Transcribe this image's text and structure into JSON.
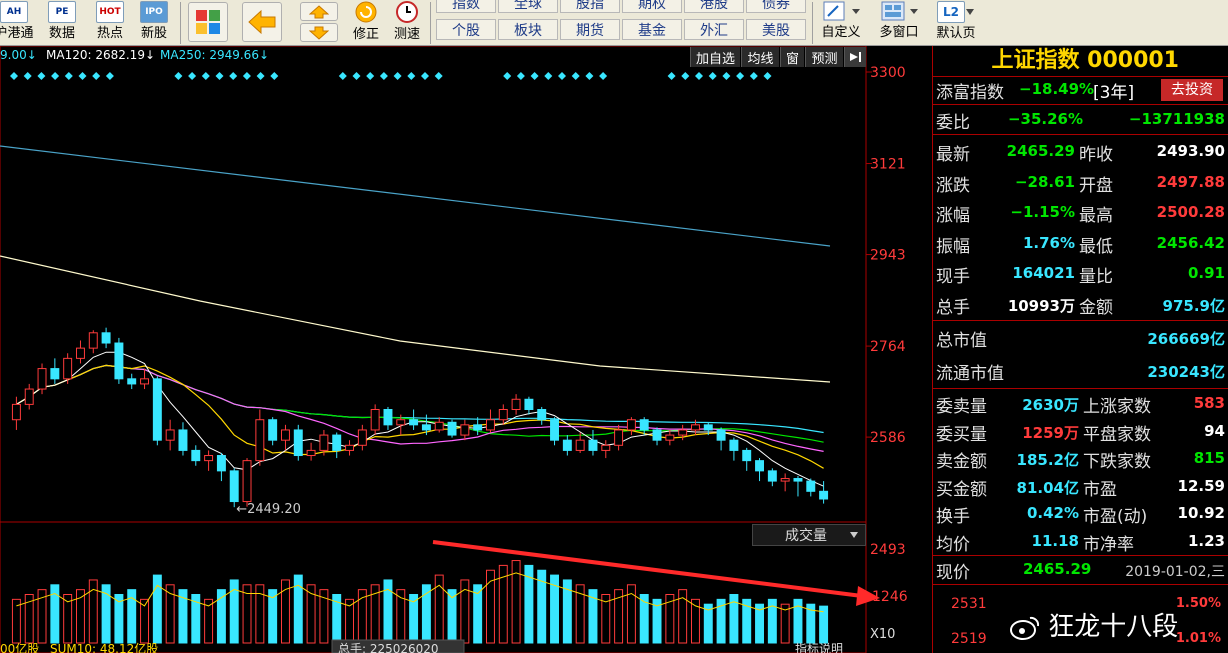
{
  "toolbar": {
    "buttons": [
      {
        "label": "沪港通",
        "icon": "AH"
      },
      {
        "label": "数据",
        "icon": "PE"
      },
      {
        "label": "热点",
        "icon": "HOT"
      },
      {
        "label": "新股",
        "icon": "IPO"
      }
    ],
    "adjust_label": "修正",
    "test_label": "测速",
    "market_grid": [
      [
        "指数",
        "全球",
        "股指",
        "期权",
        "港股",
        "债券"
      ],
      [
        "个股",
        "板块",
        "期货",
        "基金",
        "外汇",
        "美股"
      ]
    ],
    "right_buttons": [
      {
        "label": "自定义",
        "icon": "edit-icon"
      },
      {
        "label": "多窗口",
        "icon": "windows-icon"
      },
      {
        "label": "默认页",
        "icon": "L2"
      }
    ]
  },
  "chart": {
    "ma_labels": [
      {
        "text": "9.00↓",
        "color": "#39e6ff"
      },
      {
        "text": "MA120: 2682.19↓",
        "color": "#ffffff"
      },
      {
        "text": "MA250: 2949.66↓",
        "color": "#39e6ff"
      }
    ],
    "tabs": [
      "加自选",
      "均线",
      "窗",
      "预测"
    ],
    "price_ticks": [
      "3300",
      "3121",
      "2943",
      "2764",
      "2586",
      "2493",
      "1246"
    ],
    "low_marker": "←2449.20",
    "volume_dropdown": "成交量",
    "volume_x10": "X10",
    "bottom_labels": [
      "00亿股",
      "SUM10: 48.12亿股",
      "总手: 225026020",
      "指标说明"
    ],
    "colors": {
      "up": "#ff3b3b",
      "down": "#39e6ff",
      "ma5": "#ffffff",
      "ma10": "#ffd700",
      "ma20": "#ff66ff",
      "ma30": "#00e600",
      "ma60": "#39e6ff",
      "ma120": "#fffacd",
      "ma250": "#4aa3c8"
    }
  },
  "panel": {
    "title": "上证指数 000001",
    "tianfu": {
      "label": "添富指数",
      "value": "−18.49%",
      "period": "[3年]",
      "button": "去投资"
    },
    "weibi": {
      "label": "委比",
      "value": "−35.26%",
      "diff": "−13711938"
    },
    "quote_rows": [
      {
        "l1": "最新",
        "v1": "2465.29",
        "c1": "green",
        "l2": "昨收",
        "v2": "2493.90",
        "c2": "white"
      },
      {
        "l1": "涨跌",
        "v1": "−28.61",
        "c1": "green",
        "l2": "开盘",
        "v2": "2497.88",
        "c2": "red"
      },
      {
        "l1": "涨幅",
        "v1": "−1.15%",
        "c1": "green",
        "l2": "最高",
        "v2": "2500.28",
        "c2": "red"
      },
      {
        "l1": "振幅",
        "v1": "1.76%",
        "c1": "cyan",
        "l2": "最低",
        "v2": "2456.42",
        "c2": "green"
      },
      {
        "l1": "现手",
        "v1": "164021",
        "c1": "cyan",
        "l2": "量比",
        "v2": "0.91",
        "c2": "green"
      },
      {
        "l1": "总手",
        "v1": "10993万",
        "c1": "white",
        "l2": "金额",
        "v2": "975.9亿",
        "c2": "cyan"
      }
    ],
    "market_cap": [
      {
        "label": "总市值",
        "value": "266669亿"
      },
      {
        "label": "流通市值",
        "value": "230243亿"
      }
    ],
    "stats_rows": [
      {
        "l1": "委卖量",
        "v1": "2630万",
        "c1": "cyan",
        "l2": "上涨家数",
        "v2": "583",
        "c2": "red"
      },
      {
        "l1": "委买量",
        "v1": "1259万",
        "c1": "red",
        "l2": "平盘家数",
        "v2": "94",
        "c2": "white"
      },
      {
        "l1": "卖金额",
        "v1": "185.2亿",
        "c1": "cyan",
        "l2": "下跌家数",
        "v2": "815",
        "c2": "green"
      },
      {
        "l1": "买金额",
        "v1": "81.04亿",
        "c1": "cyan",
        "l2": "市盈",
        "v2": "12.59",
        "c2": "white"
      },
      {
        "l1": "换手",
        "v1": "0.42%",
        "c1": "cyan",
        "l2": "市盈(动)",
        "v2": "10.92",
        "c2": "white"
      },
      {
        "l1": "均价",
        "v1": "11.18",
        "c1": "cyan",
        "l2": "市净率",
        "v2": "1.23",
        "c2": "white"
      }
    ],
    "price_now": {
      "label": "现价",
      "value": "2465.29",
      "date": "2019-01-02,三"
    },
    "mini_ticks": [
      {
        "price": "2531",
        "pct": "1.50%"
      },
      {
        "price": "2519",
        "pct": "1.01%"
      }
    ]
  },
  "watermark": "狂龙十八段",
  "chart_data": {
    "type": "candlestick",
    "series_note": "",
    "ylim": [
      2420,
      3300
    ],
    "low_point": 2449.2,
    "candles": [
      [
        2620,
        2650,
        2600,
        2665
      ],
      [
        2650,
        2680,
        2640,
        2690
      ],
      [
        2680,
        2720,
        2670,
        2730
      ],
      [
        2720,
        2700,
        2690,
        2740
      ],
      [
        2700,
        2740,
        2690,
        2750
      ],
      [
        2740,
        2760,
        2730,
        2775
      ],
      [
        2760,
        2790,
        2750,
        2795
      ],
      [
        2790,
        2770,
        2760,
        2800
      ],
      [
        2770,
        2700,
        2690,
        2780
      ],
      [
        2700,
        2690,
        2680,
        2710
      ],
      [
        2690,
        2700,
        2680,
        2720
      ],
      [
        2700,
        2580,
        2570,
        2705
      ],
      [
        2580,
        2600,
        2560,
        2620
      ],
      [
        2600,
        2560,
        2550,
        2615
      ],
      [
        2560,
        2540,
        2530,
        2570
      ],
      [
        2540,
        2550,
        2520,
        2560
      ],
      [
        2550,
        2520,
        2500,
        2555
      ],
      [
        2520,
        2460,
        2449,
        2525
      ],
      [
        2460,
        2540,
        2450,
        2545
      ],
      [
        2540,
        2620,
        2530,
        2640
      ],
      [
        2620,
        2580,
        2570,
        2625
      ],
      [
        2580,
        2600,
        2560,
        2610
      ],
      [
        2600,
        2550,
        2540,
        2610
      ],
      [
        2550,
        2560,
        2540,
        2575
      ],
      [
        2560,
        2590,
        2550,
        2600
      ],
      [
        2590,
        2560,
        2545,
        2595
      ],
      [
        2560,
        2570,
        2550,
        2580
      ],
      [
        2570,
        2600,
        2560,
        2610
      ],
      [
        2600,
        2640,
        2590,
        2650
      ],
      [
        2640,
        2610,
        2600,
        2645
      ],
      [
        2610,
        2620,
        2590,
        2630
      ],
      [
        2620,
        2610,
        2600,
        2640
      ],
      [
        2610,
        2600,
        2590,
        2630
      ],
      [
        2600,
        2615,
        2595,
        2625
      ],
      [
        2615,
        2590,
        2585,
        2620
      ],
      [
        2590,
        2610,
        2580,
        2620
      ],
      [
        2610,
        2600,
        2590,
        2625
      ],
      [
        2600,
        2620,
        2595,
        2640
      ],
      [
        2620,
        2640,
        2610,
        2650
      ],
      [
        2640,
        2660,
        2630,
        2670
      ],
      [
        2660,
        2640,
        2630,
        2665
      ],
      [
        2640,
        2620,
        2610,
        2645
      ],
      [
        2620,
        2580,
        2570,
        2625
      ],
      [
        2580,
        2560,
        2550,
        2590
      ],
      [
        2560,
        2580,
        2555,
        2595
      ],
      [
        2580,
        2560,
        2550,
        2600
      ],
      [
        2560,
        2570,
        2545,
        2580
      ],
      [
        2570,
        2600,
        2560,
        2610
      ],
      [
        2600,
        2620,
        2590,
        2625
      ],
      [
        2620,
        2600,
        2590,
        2625
      ],
      [
        2600,
        2580,
        2570,
        2605
      ],
      [
        2580,
        2590,
        2570,
        2600
      ],
      [
        2590,
        2600,
        2580,
        2610
      ],
      [
        2600,
        2610,
        2590,
        2620
      ],
      [
        2610,
        2600,
        2590,
        2615
      ],
      [
        2600,
        2580,
        2560,
        2605
      ],
      [
        2580,
        2560,
        2540,
        2585
      ],
      [
        2560,
        2540,
        2520,
        2565
      ],
      [
        2540,
        2520,
        2500,
        2545
      ],
      [
        2520,
        2500,
        2490,
        2525
      ],
      [
        2500,
        2505,
        2480,
        2515
      ],
      [
        2505,
        2500,
        2470,
        2510
      ],
      [
        2500,
        2480,
        2470,
        2505
      ],
      [
        2480,
        2465,
        2456,
        2500
      ]
    ],
    "volumes": [
      0.45,
      0.5,
      0.55,
      0.6,
      0.5,
      0.55,
      0.65,
      0.6,
      0.5,
      0.55,
      0.45,
      0.7,
      0.6,
      0.55,
      0.5,
      0.45,
      0.55,
      0.65,
      0.6,
      0.6,
      0.55,
      0.65,
      0.7,
      0.6,
      0.55,
      0.5,
      0.45,
      0.55,
      0.6,
      0.65,
      0.55,
      0.5,
      0.6,
      0.7,
      0.55,
      0.65,
      0.6,
      0.75,
      0.8,
      0.85,
      0.8,
      0.75,
      0.7,
      0.65,
      0.6,
      0.55,
      0.5,
      0.55,
      0.6,
      0.5,
      0.45,
      0.5,
      0.55,
      0.45,
      0.4,
      0.45,
      0.5,
      0.45,
      0.4,
      0.45,
      0.4,
      0.45,
      0.4,
      0.38
    ]
  }
}
